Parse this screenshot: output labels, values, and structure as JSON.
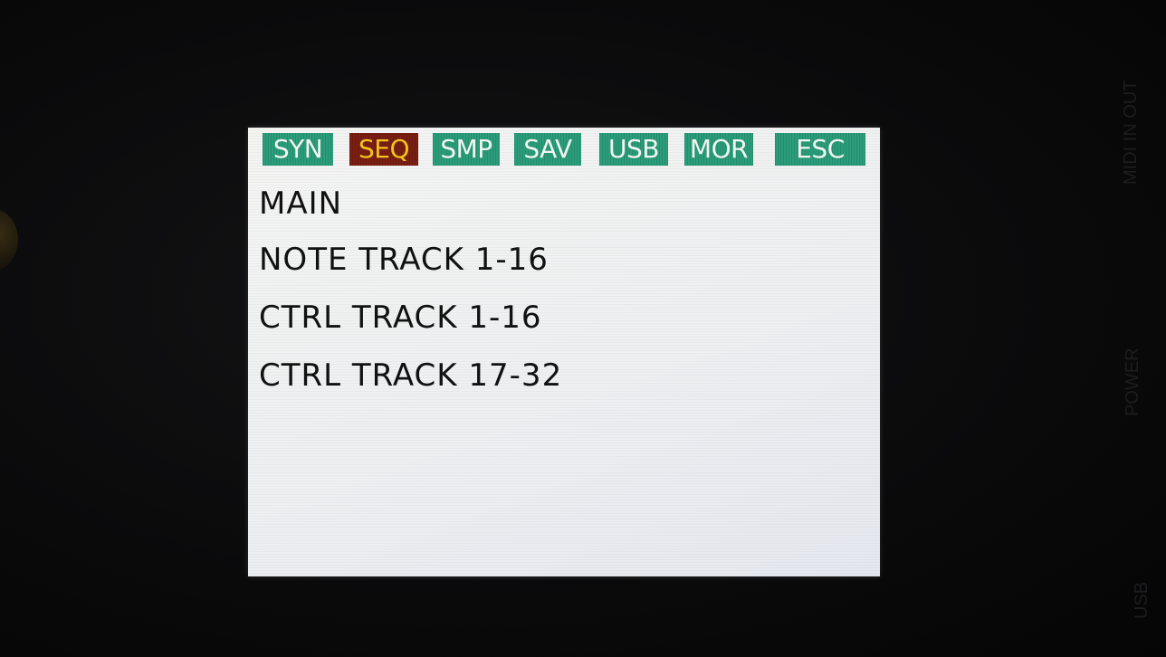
{
  "menu": {
    "tabs": [
      {
        "label": "SYN",
        "active": false
      },
      {
        "label": "SEQ",
        "active": true
      },
      {
        "label": "SMP",
        "active": false
      },
      {
        "label": "SAV",
        "active": false
      },
      {
        "label": "USB",
        "active": false
      },
      {
        "label": "MOR",
        "active": false
      },
      {
        "label": "ESC",
        "active": false
      }
    ]
  },
  "list": {
    "items": [
      "MAIN",
      "NOTE TRACK 1-16",
      "CTRL TRACK 1-16",
      "CTRL TRACK 17-32"
    ]
  },
  "panel": {
    "midi_label": "MIDI IN OUT",
    "power_label": "POWER",
    "usb_label": "USB"
  },
  "colors": {
    "tab_bg": "#2a9d7a",
    "tab_active_bg": "#7a1f12",
    "tab_active_text": "#f4c21c",
    "screen_bg": "#eef0f2"
  }
}
